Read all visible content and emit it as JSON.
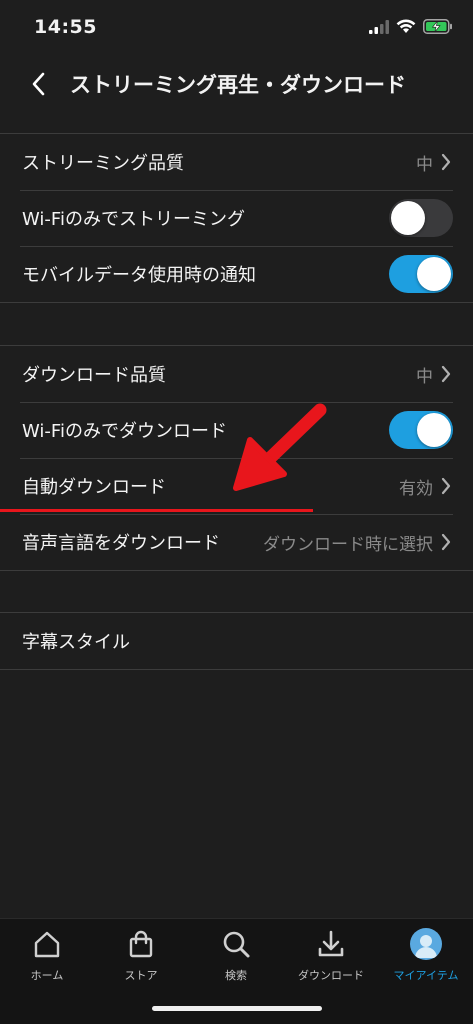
{
  "status": {
    "time": "14:55"
  },
  "nav": {
    "title": "ストリーミング再生・ダウンロード"
  },
  "streaming": {
    "quality_label": "ストリーミング品質",
    "quality_value": "中",
    "wifi_only_label": "Wi-Fiのみでストリーミング",
    "wifi_only_on": false,
    "mobile_notice_label": "モバイルデータ使用時の通知",
    "mobile_notice_on": true
  },
  "download": {
    "quality_label": "ダウンロード品質",
    "quality_value": "中",
    "wifi_only_label": "Wi-Fiのみでダウンロード",
    "wifi_only_on": true,
    "auto_label": "自動ダウンロード",
    "auto_value": "有効",
    "audio_lang_label": "音声言語をダウンロード",
    "audio_lang_value": "ダウンロード時に選択"
  },
  "subtitles": {
    "style_label": "字幕スタイル"
  },
  "tabs": [
    {
      "label": "ホーム",
      "icon": "home-icon"
    },
    {
      "label": "ストア",
      "icon": "shopping-bag-icon"
    },
    {
      "label": "検索",
      "icon": "search-icon"
    },
    {
      "label": "ダウンロード",
      "icon": "download-icon"
    },
    {
      "label": "マイアイテム",
      "icon": "avatar"
    }
  ],
  "colors": {
    "accent": "#1e9fe0",
    "annotation": "#e8161c",
    "background": "#1e1e1e"
  }
}
